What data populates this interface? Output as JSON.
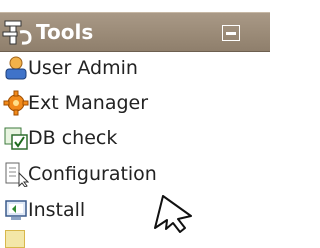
{
  "panel": {
    "title": "Tools",
    "header_icon": "wrench-tools-icon",
    "collapse_icon": "minus-icon"
  },
  "menu": {
    "items": [
      {
        "label": "User Admin",
        "icon": "user-icon"
      },
      {
        "label": "Ext Manager",
        "icon": "gear-icon"
      },
      {
        "label": "DB check",
        "icon": "db-check-icon"
      },
      {
        "label": "Configuration",
        "icon": "document-cursor-icon"
      },
      {
        "label": "Install",
        "icon": "install-icon"
      }
    ]
  },
  "colors": {
    "header_bg": "#9c8c79",
    "header_text": "#ffffff",
    "item_text": "#222222"
  }
}
